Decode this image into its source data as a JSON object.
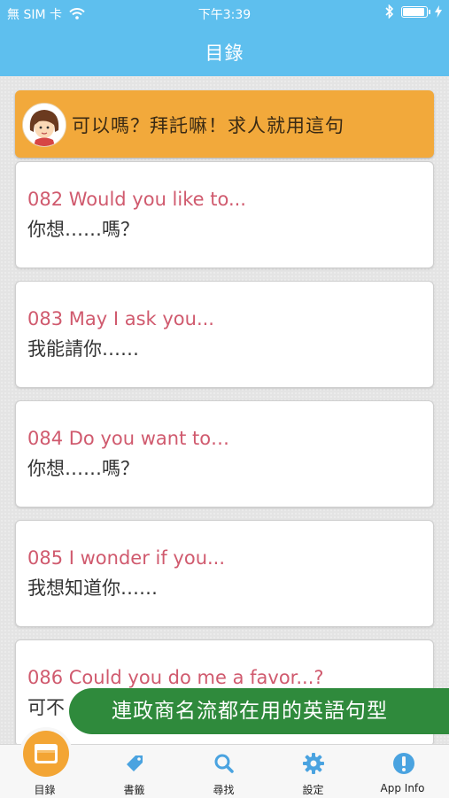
{
  "status": {
    "carrier": "無 SIM 卡",
    "time": "下午3:39"
  },
  "navbar": {
    "title": "目錄"
  },
  "header_card": {
    "text": "可以嗎？拜託嘛！求人就用這句"
  },
  "items": [
    {
      "en": "082 Would you like to...",
      "zh": "你想……嗎？"
    },
    {
      "en": "083 May I ask you...",
      "zh": "我能請你……"
    },
    {
      "en": "084 Do you want to…",
      "zh": "你想……嗎？"
    },
    {
      "en": "085 I wonder if you...",
      "zh": "我想知道你……"
    },
    {
      "en": "086 Could you do me a favor...?",
      "zh": "可不"
    }
  ],
  "banner": {
    "text": "連政商名流都在用的英語句型"
  },
  "tabs": [
    {
      "label": "目錄",
      "icon": "folder-icon"
    },
    {
      "label": "書籤",
      "icon": "tag-icon"
    },
    {
      "label": "尋找",
      "icon": "search-icon"
    },
    {
      "label": "設定",
      "icon": "gear-icon"
    },
    {
      "label": "App Info",
      "icon": "info-icon"
    }
  ],
  "colors": {
    "accent": "#5ebfee",
    "orange": "#f2a93b",
    "english_text": "#d05a6e",
    "banner": "#2f8a3c"
  },
  "battery_level": 1.0
}
